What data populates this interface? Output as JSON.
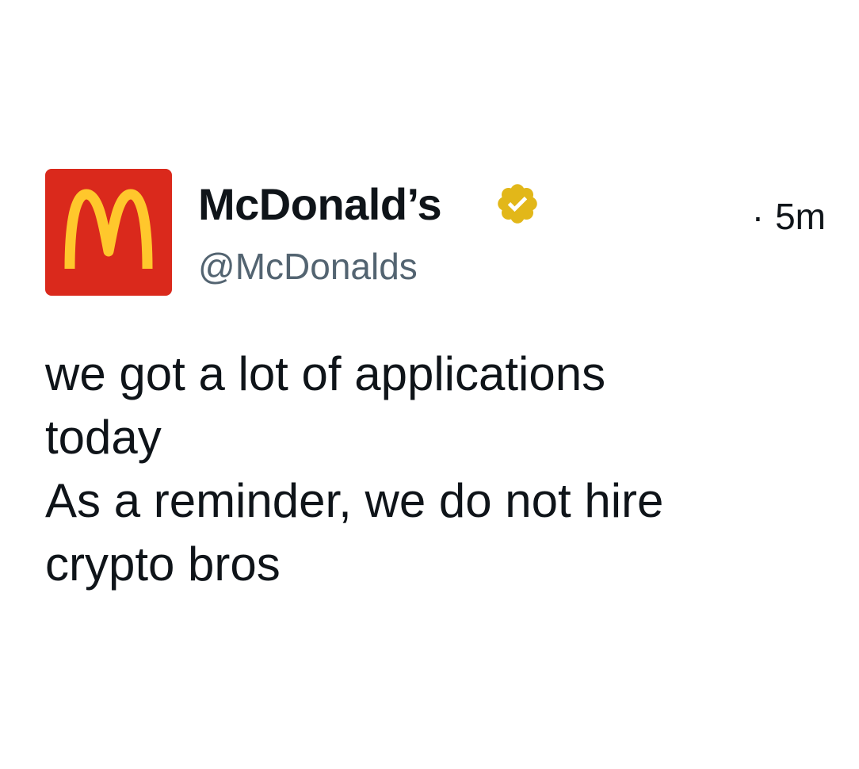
{
  "tweet": {
    "account": {
      "display_name": "McDonald’s",
      "handle": "@McDonalds",
      "avatar_icon": "mcdonalds-golden-arches-logo",
      "verified_icon": "verified-badge-icon",
      "verified_color": "#E2B719",
      "brand_color": "#DA291C",
      "arches_color": "#FFC72C"
    },
    "timestamp": {
      "separator": "·",
      "relative_time": "5m"
    },
    "text_lines": [
      "we got a lot of applications",
      "today",
      "As a reminder, we do not hire",
      "crypto bros"
    ]
  }
}
